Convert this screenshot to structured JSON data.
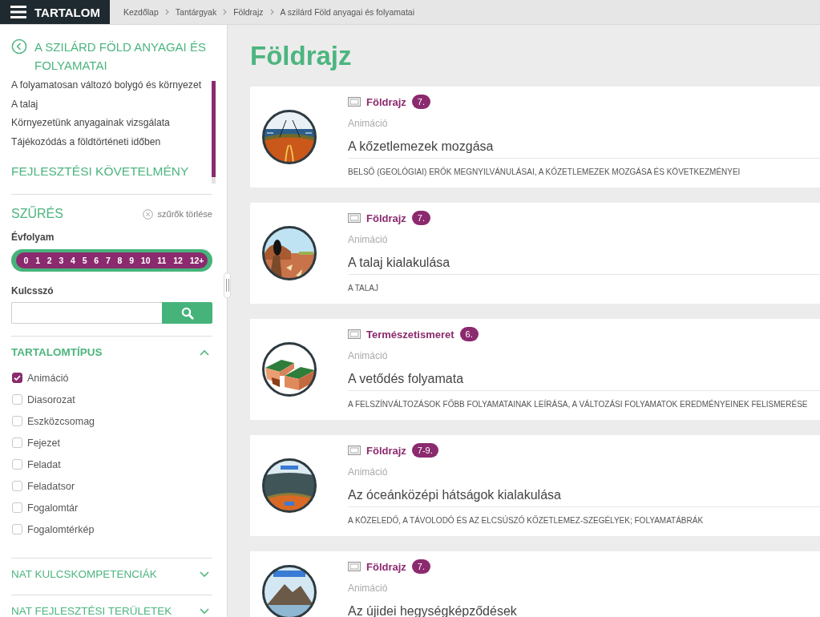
{
  "topbar": {
    "menu_label": "TARTALOM",
    "breadcrumb": [
      {
        "label": "Kezdőlap"
      },
      {
        "label": "Tantárgyak"
      },
      {
        "label": "Földrajz"
      },
      {
        "label": "A szilárd Föld anyagai és folyamatai"
      }
    ]
  },
  "sidebar": {
    "topic": {
      "title": "A SZILÁRD FÖLD ANYAGAI ÉS FOLYAMATAI",
      "items": [
        "A folyamatosan változó bolygó és környezet",
        "A talaj",
        "Környezetünk anyagainak vizsgálata",
        "Tájékozódás a földtörténeti időben"
      ],
      "section": "FEJLESZTÉSI KÖVETELMÉNY"
    },
    "filter": {
      "title": "SZŰRÉS",
      "clear_label": "szűrők törlése",
      "grade_label": "Évfolyam",
      "grades": [
        {
          "label": "0",
          "selected": true
        },
        {
          "label": "1",
          "selected": true
        },
        {
          "label": "2",
          "selected": true
        },
        {
          "label": "3",
          "selected": true
        },
        {
          "label": "4",
          "selected": true
        },
        {
          "label": "5",
          "selected": true
        },
        {
          "label": "6",
          "selected": true
        },
        {
          "label": "7",
          "selected": true
        },
        {
          "label": "8",
          "selected": true
        },
        {
          "label": "9",
          "selected": true
        },
        {
          "label": "10",
          "selected": true
        },
        {
          "label": "11",
          "selected": true
        },
        {
          "label": "12",
          "selected": true
        },
        {
          "label": "12+",
          "selected": true
        }
      ],
      "keyword_label": "Kulcsszó"
    },
    "sections": [
      {
        "title": "TARTALOMTÍPUS",
        "expanded": true,
        "options": [
          {
            "label": "Animáció",
            "checked": true
          },
          {
            "label": "Diasorozat",
            "checked": false
          },
          {
            "label": "Eszközcsomag",
            "checked": false
          },
          {
            "label": "Fejezet",
            "checked": false
          },
          {
            "label": "Feladat",
            "checked": false
          },
          {
            "label": "Feladatsor",
            "checked": false
          },
          {
            "label": "Fogalomtár",
            "checked": false
          },
          {
            "label": "Fogalomtérkép",
            "checked": false
          }
        ]
      },
      {
        "title": "NAT KULCSKOMPETENCIÁK",
        "expanded": false
      },
      {
        "title": "NAT FEJLESZTÉSI TERÜLETEK",
        "expanded": false
      }
    ]
  },
  "main": {
    "title": "Földrajz",
    "cards": [
      {
        "kind": "plates",
        "subject": "Földrajz",
        "grade": "7.",
        "type": "Animáció",
        "title": "A kőzetlemezek mozgása",
        "description": "BELSŐ (GEOLÓGIAI) ERŐK MEGNYILVÁNULÁSAI, A KŐZETLEMEZEK MOZGÁSA ÉS KÖVETKEZMÉNYEI"
      },
      {
        "kind": "soil",
        "subject": "Földrajz",
        "grade": "7.",
        "type": "Animáció",
        "title": "A talaj kialakulása",
        "description": "A TALAJ"
      },
      {
        "kind": "fault",
        "subject": "Természetismeret",
        "grade": "6.",
        "type": "Animáció",
        "title": "A vetődés folyamata",
        "description": "A FELSZÍNVÁLTOZÁSOK FŐBB FOLYAMATAINAK LEÍRÁSA, A VÁLTOZÁSI FOLYAMATOK EREDMÉNYEINEK FELISMERÉSE"
      },
      {
        "kind": "ridge",
        "subject": "Földrajz",
        "grade": "7-9.",
        "type": "Animáció",
        "title": "Az óceánközépi hátságok kialakulása",
        "description": "A KÖZELEDŐ, A TÁVOLODÓ ÉS AZ ELCSÚSZÓ KŐZETLEMEZ-SZEGÉLYEK; FOLYAMATÁBRÁK"
      },
      {
        "kind": "mountains",
        "subject": "Földrajz",
        "grade": "7.",
        "type": "Animáció",
        "title": "Az újidei hegységképződések"
      }
    ]
  }
}
